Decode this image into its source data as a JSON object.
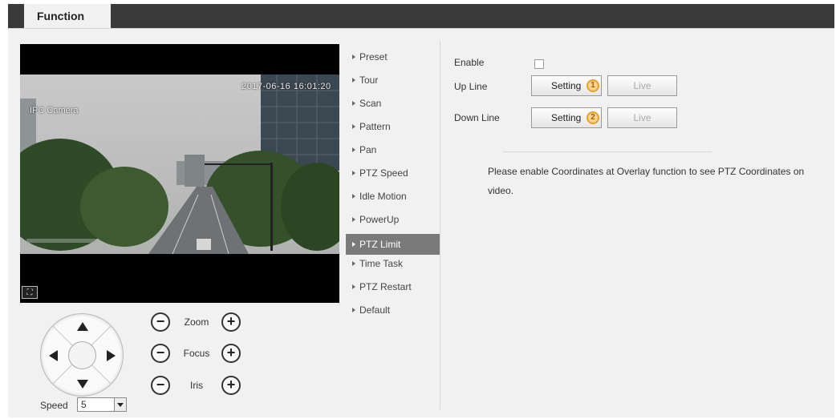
{
  "tabs": {
    "active_label": "Function"
  },
  "video": {
    "timestamp": "2017-06-16 16:01:20",
    "channel_name": "IPC Camera"
  },
  "ptz": {
    "zoom_label": "Zoom",
    "focus_label": "Focus",
    "iris_label": "Iris",
    "minus_symbol": "−",
    "plus_symbol": "+",
    "speed_label": "Speed",
    "speed_value": "5"
  },
  "menu": {
    "items": [
      {
        "label": "Preset"
      },
      {
        "label": "Tour"
      },
      {
        "label": "Scan"
      },
      {
        "label": "Pattern"
      },
      {
        "label": "Pan"
      },
      {
        "label": "PTZ Speed"
      },
      {
        "label": "Idle Motion"
      },
      {
        "label": "PowerUp"
      },
      {
        "label": "PTZ Limit"
      },
      {
        "label": "Time Task"
      },
      {
        "label": "PTZ Restart"
      },
      {
        "label": "Default"
      }
    ],
    "active_index": 8
  },
  "panel": {
    "enable_label": "Enable",
    "up_line_label": "Up Line",
    "down_line_label": "Down Line",
    "setting_label": "Setting",
    "live_label": "Live",
    "up_badge": "1",
    "down_badge": "2",
    "note": "Please enable Coordinates at Overlay function to see PTZ Coordinates on video."
  },
  "colors": {
    "tab_bar": "#3a3a3a",
    "active_menu": "#7a7a7a",
    "badge": "#ffd58a"
  }
}
